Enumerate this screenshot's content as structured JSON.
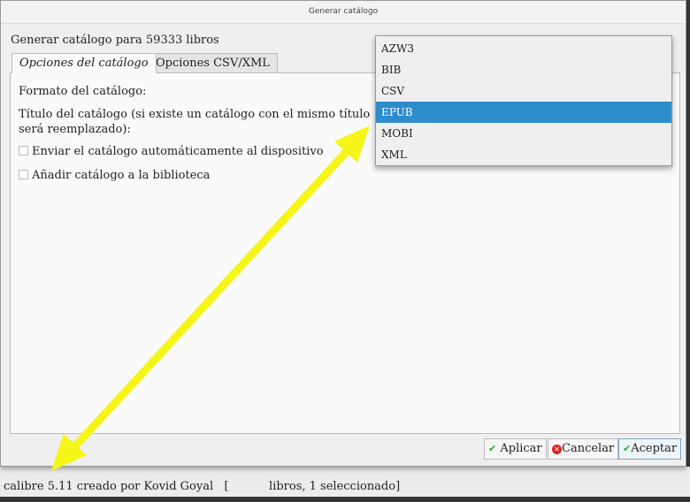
{
  "window": {
    "title": "Generar catálogo"
  },
  "heading": "Generar catálogo para 59333 libros",
  "tabs": [
    {
      "label": "Opciones del catálogo"
    },
    {
      "label": "Opciones CSV/XML"
    }
  ],
  "form": {
    "format_label": "Formato del catálogo:",
    "title_label_1": "Título del catálogo (si existe un catálogo con el mismo título",
    "title_label_2": "será reemplazado):",
    "send_checkbox": "Enviar el catálogo automáticamente al dispositivo",
    "add_checkbox": "Añadir catálogo a la biblioteca"
  },
  "format_dropdown": {
    "options": [
      "AZW3",
      "BIB",
      "CSV",
      "EPUB",
      "MOBI",
      "XML"
    ],
    "selected": "EPUB"
  },
  "buttons": {
    "apply": "Aplicar",
    "cancel": "Cancelar",
    "ok": "Aceptar"
  },
  "statusbar": "calibre 5.11 creado por Kovid Goyal   [           libros, 1 seleccionado]",
  "colors": {
    "selection": "#2e8ccc",
    "annotation_arrow": "#f5f518"
  }
}
